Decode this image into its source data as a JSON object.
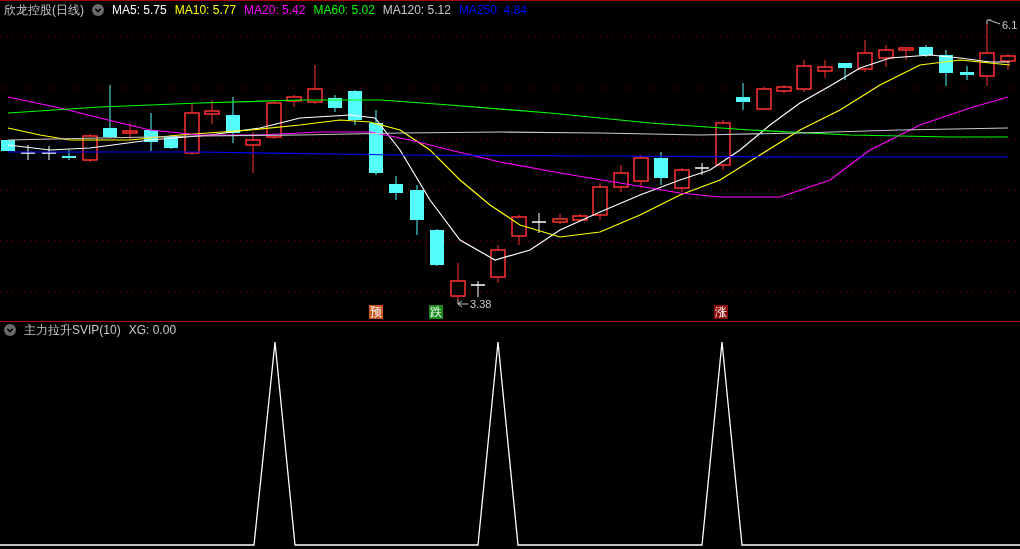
{
  "main_panel": {
    "title": "欣龙控股(日线)",
    "moving_averages": [
      {
        "text": "MA5: 5.75",
        "color": "#ffffff"
      },
      {
        "text": "MA10: 5.77",
        "color": "#ffff00"
      },
      {
        "text": "MA20: 5.42",
        "color": "#ff00ff"
      },
      {
        "text": "MA60: 5.02",
        "color": "#00ff00"
      },
      {
        "text": "MA120: 5.12",
        "color": "#c8c8c8"
      },
      {
        "text": "MA250: 4.84",
        "color": "#0000ff"
      }
    ],
    "price_labels": [
      {
        "kind": "high",
        "text": "6.1"
      },
      {
        "kind": "low",
        "text": "3.38"
      }
    ],
    "signals": [
      {
        "text": "预",
        "color": "#c8561e"
      },
      {
        "text": "跌",
        "color": "#1a8a1a"
      },
      {
        "text": "涨",
        "color": "#8b0a0a"
      }
    ]
  },
  "indicator_panel": {
    "title": "主力拉升SVIP(10)",
    "readings": [
      {
        "text": "XG: 0.00"
      }
    ]
  }
}
